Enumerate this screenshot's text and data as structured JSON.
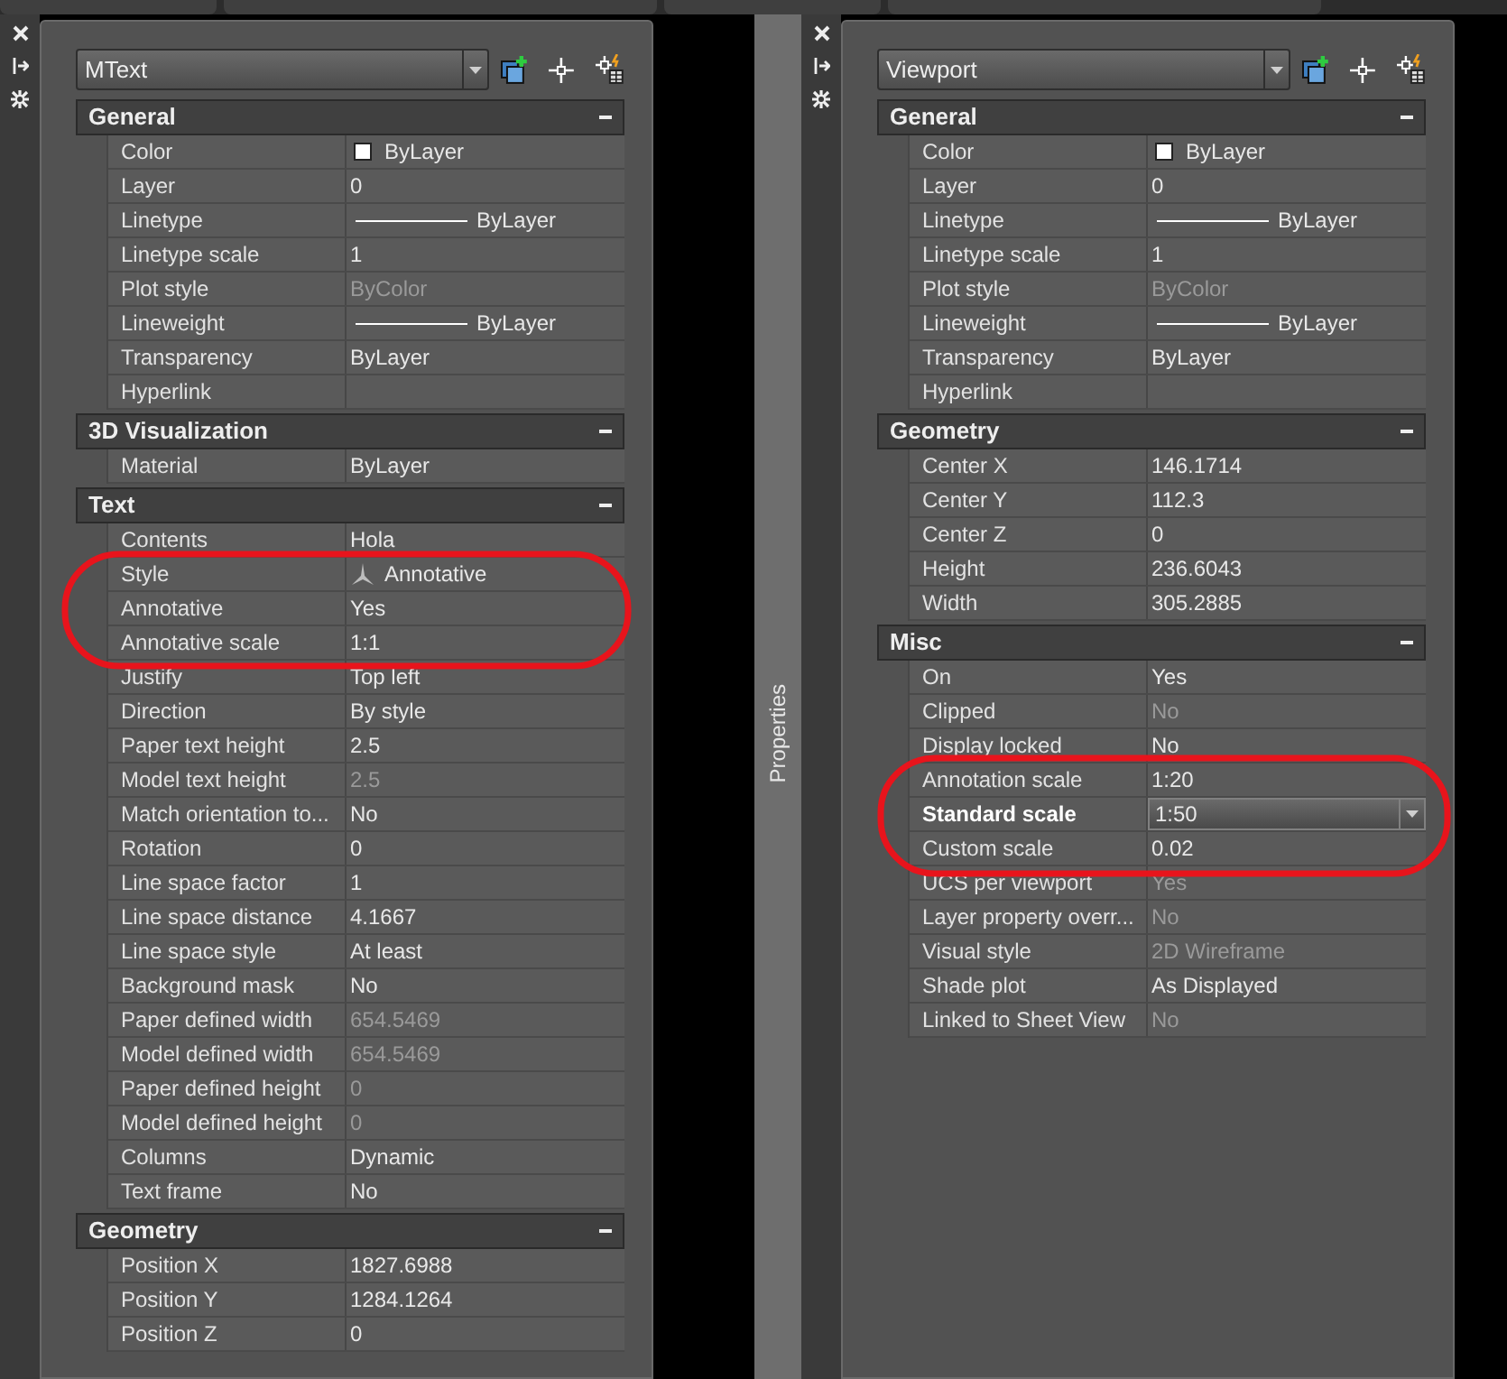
{
  "left_palette": {
    "object_type": "MText",
    "sections": [
      {
        "title": "General",
        "rows": [
          {
            "label": "Color",
            "value": "ByLayer",
            "kind": "swatch",
            "disabled": false,
            "selected": false
          },
          {
            "label": "Layer",
            "value": "0",
            "kind": "text",
            "disabled": false,
            "selected": false
          },
          {
            "label": "Linetype",
            "value": "ByLayer",
            "kind": "line",
            "disabled": false,
            "selected": false
          },
          {
            "label": "Linetype scale",
            "value": "1",
            "kind": "text",
            "disabled": false,
            "selected": false
          },
          {
            "label": "Plot style",
            "value": "ByColor",
            "kind": "text",
            "disabled": true,
            "selected": false
          },
          {
            "label": "Lineweight",
            "value": "ByLayer",
            "kind": "line",
            "disabled": false,
            "selected": false
          },
          {
            "label": "Transparency",
            "value": "ByLayer",
            "kind": "text",
            "disabled": false,
            "selected": false
          },
          {
            "label": "Hyperlink",
            "value": "",
            "kind": "text",
            "disabled": false,
            "selected": false
          }
        ]
      },
      {
        "title": "3D Visualization",
        "rows": [
          {
            "label": "Material",
            "value": "ByLayer",
            "kind": "text",
            "disabled": false,
            "selected": false
          }
        ]
      },
      {
        "title": "Text",
        "rows": [
          {
            "label": "Contents",
            "value": "Hola",
            "kind": "text",
            "disabled": false,
            "selected": false
          },
          {
            "label": "Style",
            "value": "Annotative",
            "kind": "style",
            "disabled": false,
            "selected": false
          },
          {
            "label": "Annotative",
            "value": "Yes",
            "kind": "text",
            "disabled": false,
            "selected": false
          },
          {
            "label": "Annotative scale",
            "value": "1:1",
            "kind": "text",
            "disabled": false,
            "selected": false
          },
          {
            "label": "Justify",
            "value": "Top left",
            "kind": "text",
            "disabled": false,
            "selected": false
          },
          {
            "label": "Direction",
            "value": "By style",
            "kind": "text",
            "disabled": false,
            "selected": false
          },
          {
            "label": "Paper text height",
            "value": "2.5",
            "kind": "text",
            "disabled": false,
            "selected": false
          },
          {
            "label": "Model text height",
            "value": "2.5",
            "kind": "text",
            "disabled": true,
            "selected": false
          },
          {
            "label": "Match orientation to...",
            "value": "No",
            "kind": "text",
            "disabled": false,
            "selected": false
          },
          {
            "label": "Rotation",
            "value": "0",
            "kind": "text",
            "disabled": false,
            "selected": false
          },
          {
            "label": "Line space factor",
            "value": "1",
            "kind": "text",
            "disabled": false,
            "selected": false
          },
          {
            "label": "Line space distance",
            "value": "4.1667",
            "kind": "text",
            "disabled": false,
            "selected": false
          },
          {
            "label": "Line space style",
            "value": "At least",
            "kind": "text",
            "disabled": false,
            "selected": false
          },
          {
            "label": "Background mask",
            "value": "No",
            "kind": "text",
            "disabled": false,
            "selected": false
          },
          {
            "label": "Paper defined width",
            "value": "654.5469",
            "kind": "text",
            "disabled": true,
            "selected": false
          },
          {
            "label": "Model defined width",
            "value": "654.5469",
            "kind": "text",
            "disabled": true,
            "selected": false
          },
          {
            "label": "Paper defined height",
            "value": "0",
            "kind": "text",
            "disabled": true,
            "selected": false
          },
          {
            "label": "Model defined height",
            "value": "0",
            "kind": "text",
            "disabled": true,
            "selected": false
          },
          {
            "label": "Columns",
            "value": "Dynamic",
            "kind": "text",
            "disabled": false,
            "selected": false
          },
          {
            "label": "Text frame",
            "value": "No",
            "kind": "text",
            "disabled": false,
            "selected": false
          }
        ]
      },
      {
        "title": "Geometry",
        "rows": [
          {
            "label": "Position X",
            "value": "1827.6988",
            "kind": "text",
            "disabled": false,
            "selected": false
          },
          {
            "label": "Position Y",
            "value": "1284.1264",
            "kind": "text",
            "disabled": false,
            "selected": false
          },
          {
            "label": "Position Z",
            "value": "0",
            "kind": "text",
            "disabled": false,
            "selected": false
          }
        ]
      }
    ]
  },
  "collapsed_palette": {
    "title": "Properties"
  },
  "right_palette": {
    "object_type": "Viewport",
    "sections": [
      {
        "title": "General",
        "rows": [
          {
            "label": "Color",
            "value": "ByLayer",
            "kind": "swatch",
            "disabled": false,
            "selected": false
          },
          {
            "label": "Layer",
            "value": "0",
            "kind": "text",
            "disabled": false,
            "selected": false
          },
          {
            "label": "Linetype",
            "value": "ByLayer",
            "kind": "line",
            "disabled": false,
            "selected": false
          },
          {
            "label": "Linetype scale",
            "value": "1",
            "kind": "text",
            "disabled": false,
            "selected": false
          },
          {
            "label": "Plot style",
            "value": "ByColor",
            "kind": "text",
            "disabled": true,
            "selected": false
          },
          {
            "label": "Lineweight",
            "value": "ByLayer",
            "kind": "line",
            "disabled": false,
            "selected": false
          },
          {
            "label": "Transparency",
            "value": "ByLayer",
            "kind": "text",
            "disabled": false,
            "selected": false
          },
          {
            "label": "Hyperlink",
            "value": "",
            "kind": "text",
            "disabled": false,
            "selected": false
          }
        ]
      },
      {
        "title": "Geometry",
        "rows": [
          {
            "label": "Center X",
            "value": "146.1714",
            "kind": "text",
            "disabled": false,
            "selected": false
          },
          {
            "label": "Center Y",
            "value": "112.3",
            "kind": "text",
            "disabled": false,
            "selected": false
          },
          {
            "label": "Center Z",
            "value": "0",
            "kind": "text",
            "disabled": false,
            "selected": false
          },
          {
            "label": "Height",
            "value": "236.6043",
            "kind": "text",
            "disabled": false,
            "selected": false
          },
          {
            "label": "Width",
            "value": "305.2885",
            "kind": "text",
            "disabled": false,
            "selected": false
          }
        ]
      },
      {
        "title": "Misc",
        "rows": [
          {
            "label": "On",
            "value": "Yes",
            "kind": "text",
            "disabled": false,
            "selected": false
          },
          {
            "label": "Clipped",
            "value": "No",
            "kind": "text",
            "disabled": true,
            "selected": false
          },
          {
            "label": "Display locked",
            "value": "No",
            "kind": "text",
            "disabled": false,
            "selected": false
          },
          {
            "label": "Annotation scale",
            "value": "1:20",
            "kind": "text",
            "disabled": false,
            "selected": false
          },
          {
            "label": "Standard scale",
            "value": "1:50",
            "kind": "text",
            "disabled": false,
            "selected": true
          },
          {
            "label": "Custom scale",
            "value": "0.02",
            "kind": "text",
            "disabled": false,
            "selected": false
          },
          {
            "label": "UCS per viewport",
            "value": "Yes",
            "kind": "text",
            "disabled": true,
            "selected": false
          },
          {
            "label": "Layer property overr...",
            "value": "No",
            "kind": "text",
            "disabled": true,
            "selected": false
          },
          {
            "label": "Visual style",
            "value": "2D Wireframe",
            "kind": "text",
            "disabled": true,
            "selected": false
          },
          {
            "label": "Shade plot",
            "value": "As Displayed",
            "kind": "text",
            "disabled": false,
            "selected": false
          },
          {
            "label": "Linked to Sheet View",
            "value": "No",
            "kind": "text",
            "disabled": true,
            "selected": false
          }
        ]
      }
    ]
  }
}
